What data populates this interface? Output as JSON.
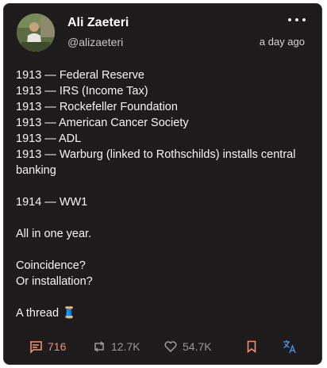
{
  "post": {
    "author_name": "Ali Zaeteri",
    "author_handle": "@alizaeteri",
    "timestamp": "a day ago",
    "lines": [
      "1913 — Federal Reserve",
      "1913 — IRS  (Income Tax)",
      "1913 — Rockefeller Foundation",
      "1913 — American Cancer Society",
      "1913 — ADL",
      "1913 — Warburg (linked to Rothschilds) installs central banking",
      "",
      "1914 — WW1",
      "",
      "All in one year.",
      "",
      "Coincidence?",
      "Or installation?",
      "",
      "A thread 🧵"
    ]
  },
  "actions": {
    "replies": "716",
    "reposts": "12.7K",
    "likes": "54.7K"
  },
  "icons": {
    "more": "more-horizontal-icon",
    "reply": "comment-icon",
    "repost": "repost-icon",
    "like": "heart-icon",
    "bookmark": "bookmark-icon",
    "translate": "translate-icon"
  },
  "colors": {
    "card_background": "#1e1b1c",
    "reply_accent": "#f08f72",
    "translate_accent": "#4a90e2",
    "muted": "#9a9697"
  }
}
